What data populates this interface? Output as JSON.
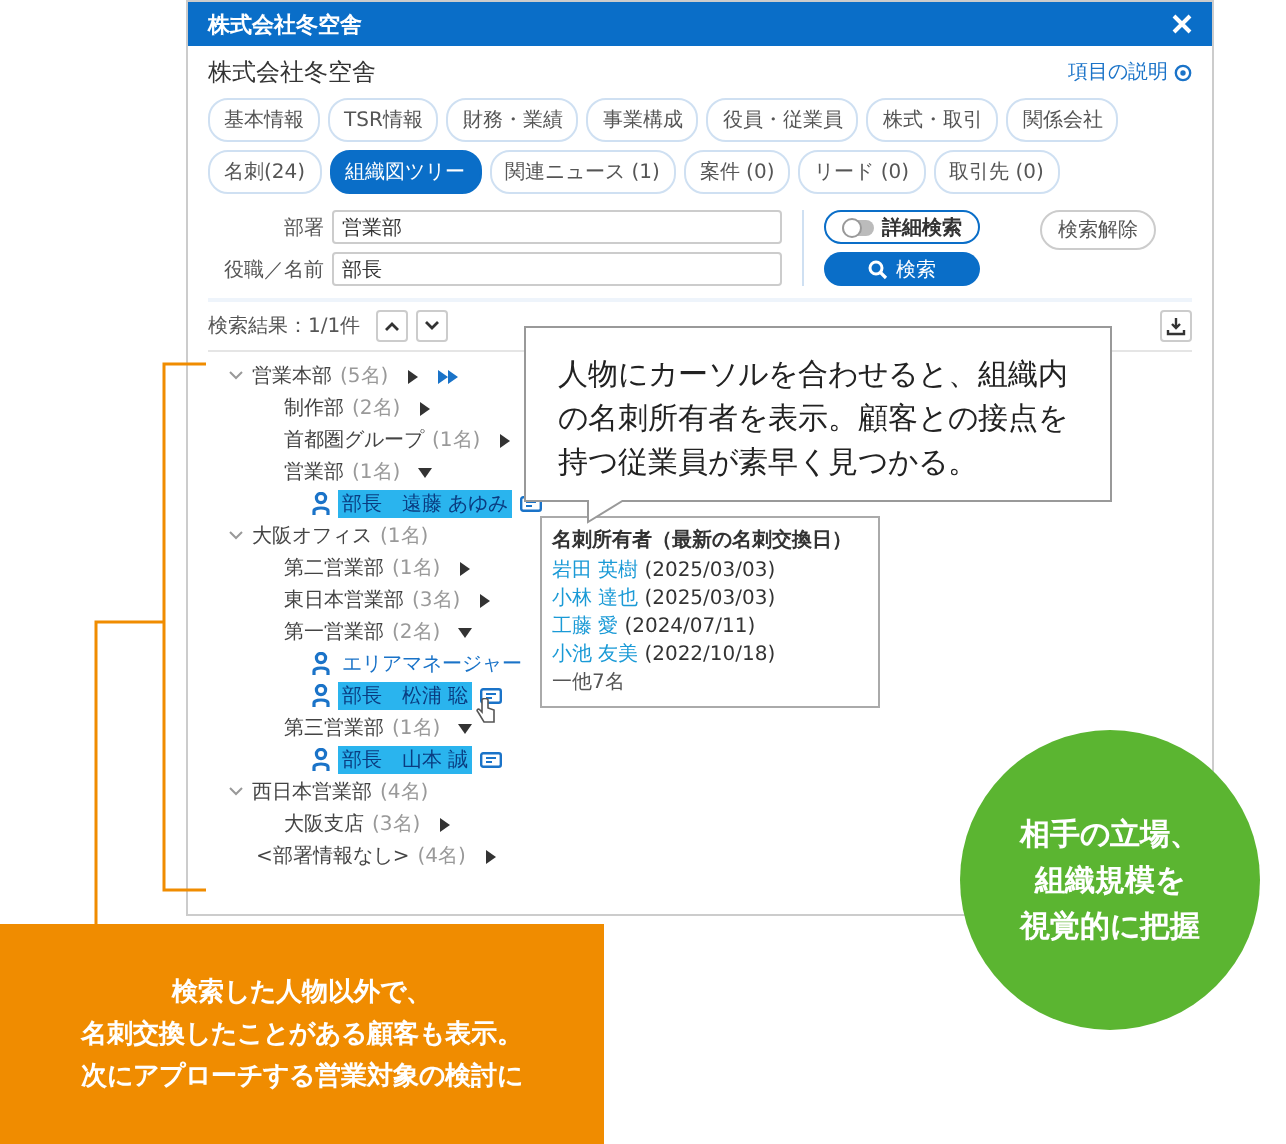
{
  "window": {
    "title": "株式会社冬空舎"
  },
  "company": "株式会社冬空舎",
  "help_link": "項目の説明",
  "tabs": [
    {
      "label": "基本情報",
      "selected": false
    },
    {
      "label": "TSR情報",
      "selected": false
    },
    {
      "label": "財務・業績",
      "selected": false
    },
    {
      "label": "事業構成",
      "selected": false
    },
    {
      "label": "役員・従業員",
      "selected": false
    },
    {
      "label": "株式・取引",
      "selected": false
    },
    {
      "label": "関係会社",
      "selected": false
    },
    {
      "label": "名刺(24)",
      "selected": false
    },
    {
      "label": "組織図ツリー",
      "selected": true
    },
    {
      "label": "関連ニュース (1)",
      "selected": false
    },
    {
      "label": "案件 (0)",
      "selected": false
    },
    {
      "label": "リード (0)",
      "selected": false
    },
    {
      "label": "取引先 (0)",
      "selected": false
    }
  ],
  "form": {
    "fields": [
      {
        "label": "部署",
        "value": "営業部"
      },
      {
        "label": "役職／名前",
        "value": "部長"
      }
    ],
    "advanced": {
      "label": "詳細検索",
      "on": false
    },
    "search_button": "検索",
    "clear_button": "検索解除"
  },
  "results": {
    "summary": "検索結果：1/1件"
  },
  "tree": [
    {
      "kind": "group",
      "label": "営業本部",
      "count": "(5名)",
      "expanded": true,
      "submenu": true,
      "jump": true,
      "children": [
        {
          "kind": "dept",
          "label": "制作部",
          "count": "(2名)",
          "expanded": false
        },
        {
          "kind": "dept",
          "label": "首都圏グループ",
          "count": "(1名)",
          "expanded": false
        },
        {
          "kind": "dept",
          "label": "営業部",
          "count": "(1名)",
          "expanded": true,
          "children": [
            {
              "kind": "person",
              "label": "部長　遠藤 あゆみ",
              "selected": true,
              "card": true,
              "hovered": false
            }
          ]
        }
      ]
    },
    {
      "kind": "group",
      "label": "大阪オフィス",
      "count": "(1名)",
      "expanded": true,
      "children": [
        {
          "kind": "dept",
          "label": "第二営業部",
          "count": "(1名)",
          "expanded": false
        },
        {
          "kind": "dept",
          "label": "東日本営業部",
          "count": "(3名)",
          "expanded": false
        },
        {
          "kind": "dept",
          "label": "第一営業部",
          "count": "(2名)",
          "expanded": true,
          "children": [
            {
              "kind": "person",
              "label": "エリアマネージャー",
              "selected": false,
              "card": false,
              "hovered": false
            },
            {
              "kind": "person",
              "label": "部長　松浦 聡",
              "selected": true,
              "card": true,
              "hovered": true
            }
          ]
        },
        {
          "kind": "dept",
          "label": "第三営業部",
          "count": "(1名)",
          "expanded": true,
          "children": [
            {
              "kind": "person",
              "label": "部長　山本 誠",
              "selected": true,
              "card": true,
              "hovered": false
            }
          ]
        }
      ]
    },
    {
      "kind": "group",
      "label": "西日本営業部",
      "count": "(4名)",
      "expanded": true,
      "children": [
        {
          "kind": "dept",
          "label": "大阪支店",
          "count": "(3名)",
          "expanded": false
        }
      ]
    },
    {
      "kind": "dept",
      "label": "<部署情報なし>",
      "count": "(4名)",
      "expanded": false
    }
  ],
  "tooltip": {
    "title": "名刺所有者（最新の名刺交換日）",
    "entries": [
      {
        "name": "岩田 英樹",
        "date": "(2025/03/03)"
      },
      {
        "name": "小林 達也",
        "date": "(2025/03/03)"
      },
      {
        "name": "工藤 愛",
        "date": "(2024/07/11)"
      },
      {
        "name": "小池 友美",
        "date": "(2022/10/18)"
      }
    ],
    "more": "一他7名"
  },
  "callouts": {
    "bubble": "人物にカーソルを合わせると、組織内の名刺所有者を表示。顧客との接点を持つ従業員が素早く見つかる。",
    "note": [
      "検索した人物以外で、",
      "名刺交換したことがある顧客も表示。",
      "次にアプローチする営業対象の検討に"
    ],
    "circle": [
      "相手の立場、",
      "組織規模を",
      "視覚的に把握"
    ]
  }
}
